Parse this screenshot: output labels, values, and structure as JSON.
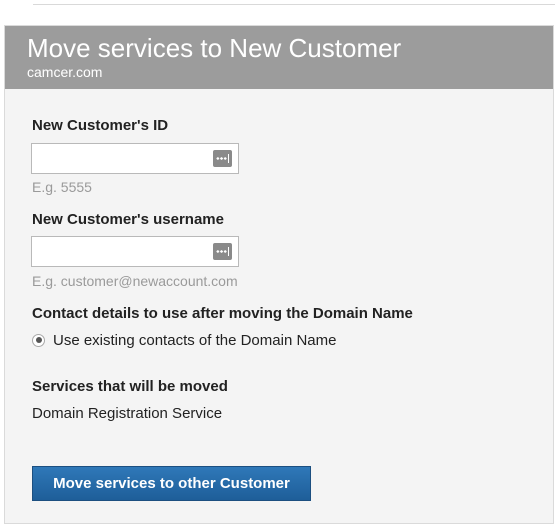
{
  "header": {
    "title": "Move services to New Customer",
    "subtitle": "camcer.com"
  },
  "form": {
    "customer_id": {
      "label": "New Customer's ID",
      "value": "",
      "hint": "E.g. 5555"
    },
    "username": {
      "label": "New Customer's username",
      "value": "",
      "hint": "E.g. customer@newaccount.com"
    },
    "contacts": {
      "label": "Contact details to use after moving the Domain Name",
      "option_label": "Use existing contacts of the Domain Name",
      "selected": true
    },
    "services": {
      "label": "Services that will be moved",
      "value": "Domain Registration Service"
    },
    "submit_label": "Move services to other Customer"
  },
  "icons": {
    "field_icon": "password-manager-key-icon"
  },
  "colors": {
    "header_bg": "#9c9c9c",
    "panel_bg": "#f4f4f4",
    "button_bg": "#2a6fae",
    "hint_text": "#9a9a9a"
  }
}
